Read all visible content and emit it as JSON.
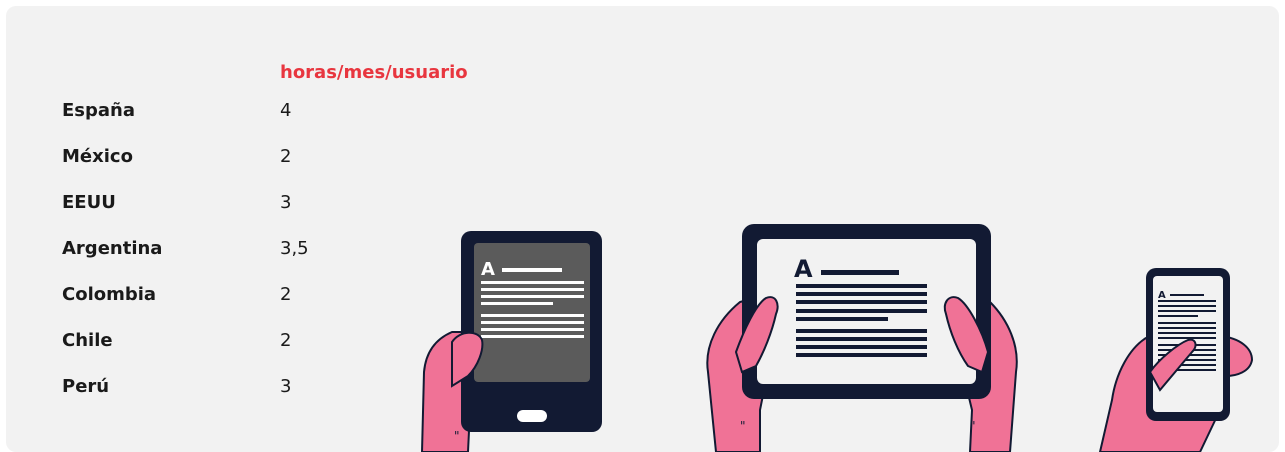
{
  "table": {
    "header": "horas/mes/usuario",
    "rows": [
      {
        "country": "España",
        "value": "4"
      },
      {
        "country": "México",
        "value": "2"
      },
      {
        "country": "EEUU",
        "value": "3"
      },
      {
        "country": "Argentina",
        "value": "3,5"
      },
      {
        "country": "Colombia",
        "value": "2"
      },
      {
        "country": "Chile",
        "value": "2"
      },
      {
        "country": "Perú",
        "value": "3"
      }
    ]
  },
  "illustration": {
    "device_letter": "A",
    "colors": {
      "header": "#e8363f",
      "skin": "#f07296",
      "device": "#121a33",
      "screen_dark": "#5b5b5b",
      "screen_light": "#f2f2f2"
    }
  }
}
